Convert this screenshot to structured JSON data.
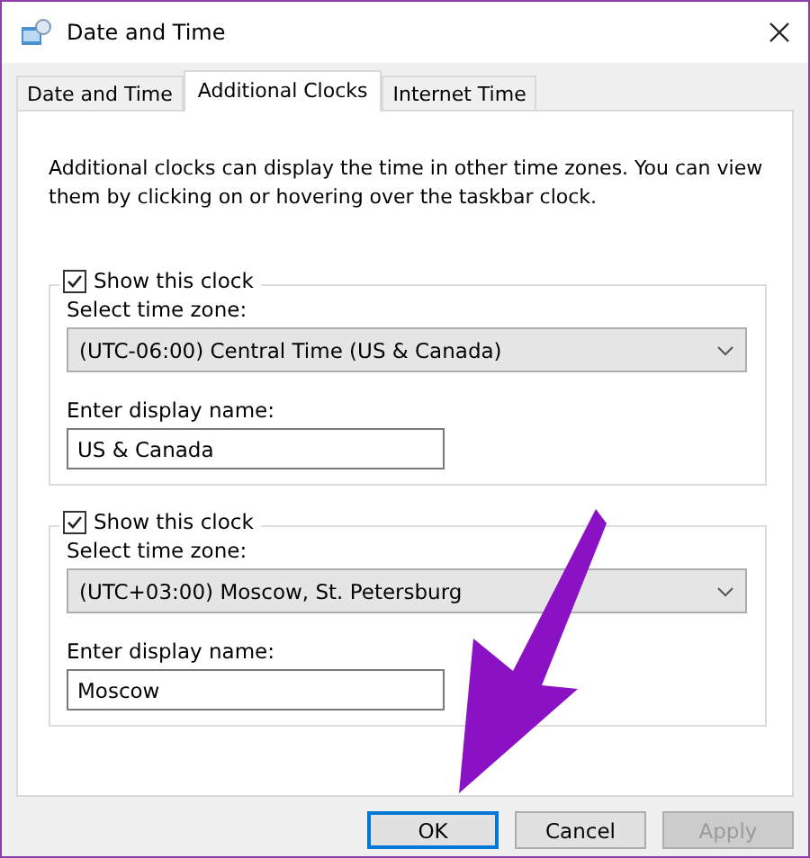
{
  "window": {
    "title": "Date and Time"
  },
  "tabs": [
    {
      "label": "Date and Time",
      "selected": false
    },
    {
      "label": "Additional Clocks",
      "selected": true
    },
    {
      "label": "Internet Time",
      "selected": false
    }
  ],
  "description": "Additional clocks can display the time in other time zones. You can view them by clicking on or hovering over the taskbar clock.",
  "clocks": [
    {
      "show_label": "Show this clock",
      "checked": true,
      "zone_label": "Select time zone:",
      "zone": "(UTC-06:00) Central Time (US & Canada)",
      "name_label": "Enter display name:",
      "name": "US & Canada"
    },
    {
      "show_label": "Show this clock",
      "checked": true,
      "zone_label": "Select time zone:",
      "zone": "(UTC+03:00) Moscow, St. Petersburg",
      "name_label": "Enter display name:",
      "name": "Moscow"
    }
  ],
  "buttons": [
    {
      "label": "OK",
      "default": true,
      "disabled": false
    },
    {
      "label": "Cancel",
      "default": false,
      "disabled": false
    },
    {
      "label": "Apply",
      "default": false,
      "disabled": true
    }
  ],
  "annotation": {
    "kind": "arrow"
  }
}
